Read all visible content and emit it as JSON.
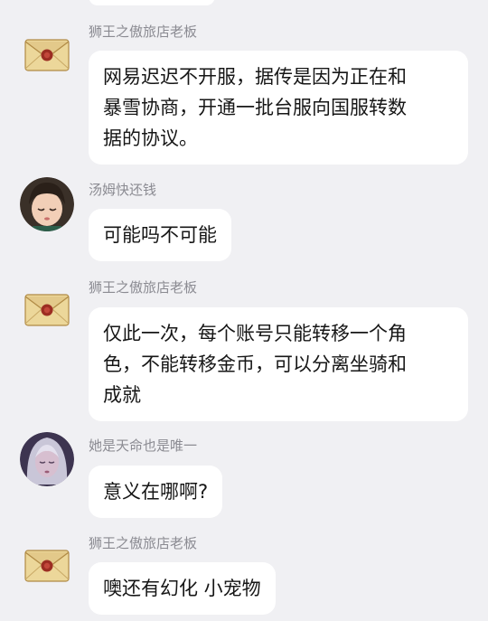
{
  "messages": [
    {
      "sender": "狮王之傲旅店老板",
      "avatar_icon": "envelope-seal-icon",
      "lines": [
        "网易迟迟不开服，据传是因为正在和",
        "暴雪协商，开通一批台服向国服转数",
        "据的协议。"
      ]
    },
    {
      "sender": "汤姆快还钱",
      "avatar_icon": "doll-girl-avatar-icon",
      "lines": [
        "可能吗不可能"
      ]
    },
    {
      "sender": "狮王之傲旅店老板",
      "avatar_icon": "envelope-seal-icon",
      "lines": [
        "仅此一次，每个账号只能转移一个角",
        "色，不能转移金币，可以分离坐骑和",
        "成就"
      ]
    },
    {
      "sender": "她是天命也是唯一",
      "avatar_icon": "silver-hair-avatar-icon",
      "lines": [
        "意义在哪啊?"
      ]
    },
    {
      "sender": "狮王之傲旅店老板",
      "avatar_icon": "envelope-seal-icon",
      "lines": [
        "噢还有幻化 小宠物"
      ]
    }
  ]
}
